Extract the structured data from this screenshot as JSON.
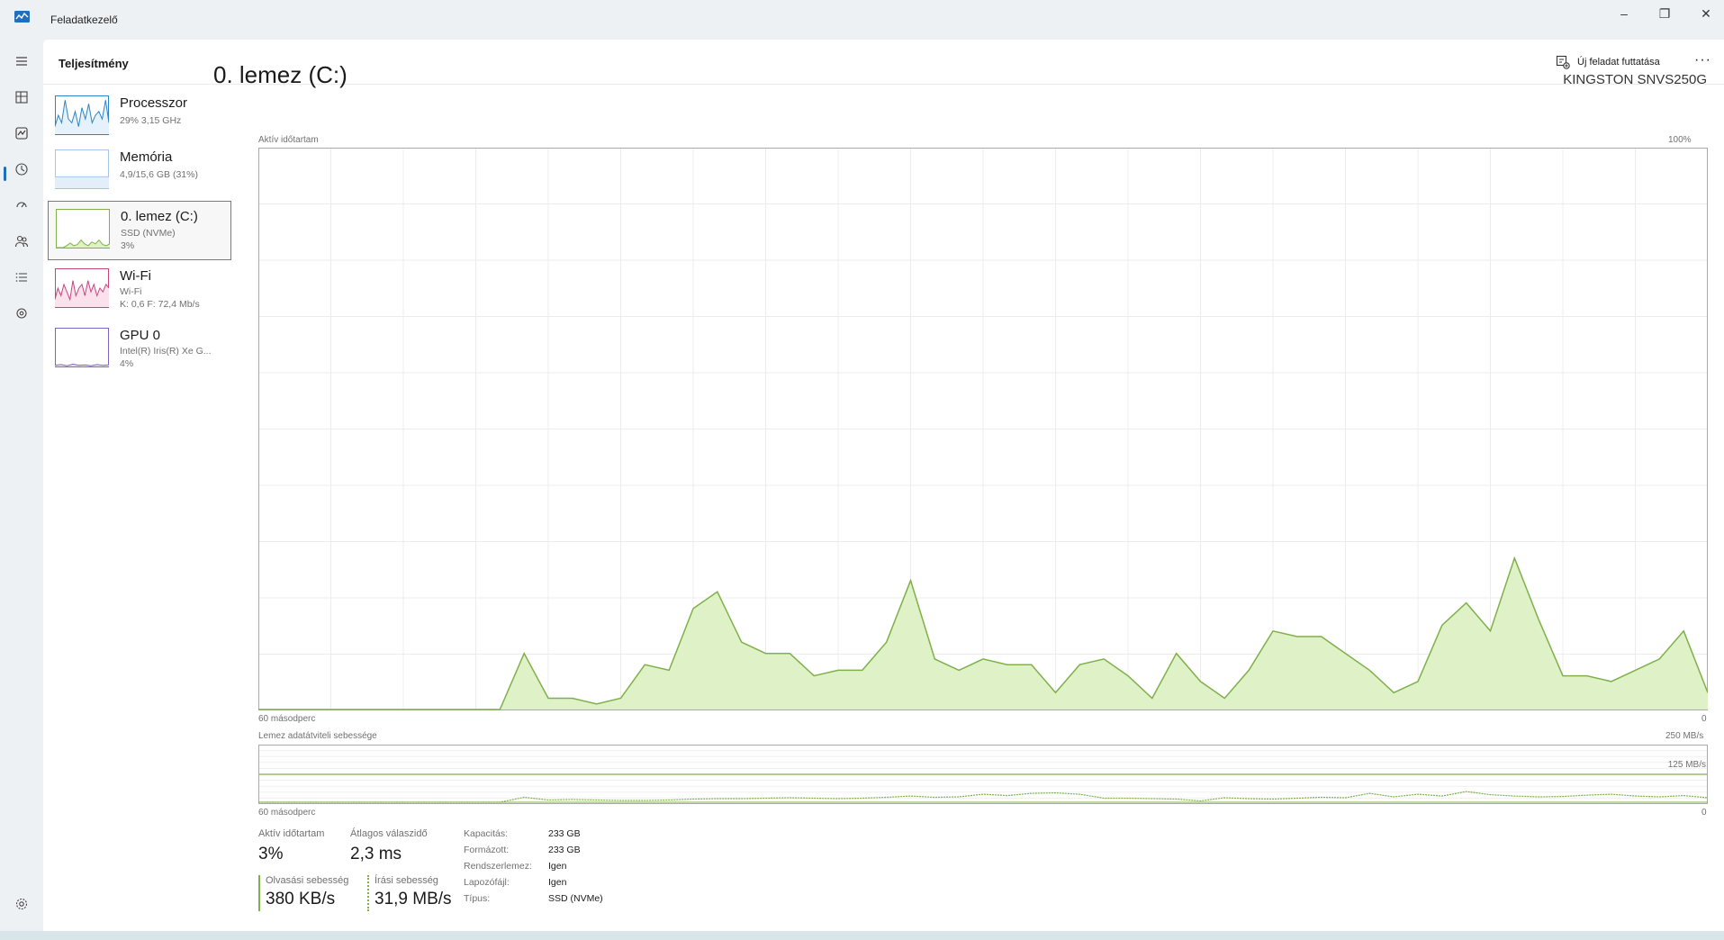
{
  "window": {
    "title": "Feladatkezelő",
    "minimize": "–",
    "maximize": "❐",
    "close": "✕"
  },
  "header": {
    "page_title": "Teljesítmény",
    "run_task_label": "Új feladat futtatása",
    "more_label": "···"
  },
  "devices": [
    {
      "name": "Processzor",
      "line1": "29% 3,15 GHz",
      "line2": ""
    },
    {
      "name": "Memória",
      "line1": "4,9/15,6 GB (31%)",
      "line2": ""
    },
    {
      "name": "0. lemez (C:)",
      "line1": "SSD (NVMe)",
      "line2": "3%"
    },
    {
      "name": "Wi-Fi",
      "line1": "Wi-Fi",
      "line2": "K: 0,6 F: 72,4 Mb/s"
    },
    {
      "name": "GPU 0",
      "line1": "Intel(R) Iris(R) Xe G...",
      "line2": "4%"
    }
  ],
  "detail": {
    "title": "0. lemez (C:)",
    "model": "KINGSTON SNVS250G",
    "active_chart_label": "Aktív időtartam",
    "active_chart_max": "100%",
    "time_left": "60 másodperc",
    "time_right": "0",
    "transfer_label": "Lemez adatátviteli sebessége",
    "transfer_max": "250 MB/s",
    "transfer_mid": "125 MB/s",
    "transfer_time_left": "60 másodperc",
    "transfer_time_right": "0"
  },
  "stats": {
    "active_label": "Aktív időtartam",
    "active_value": "3%",
    "response_label": "Átlagos válaszidő",
    "response_value": "2,3 ms",
    "read_label": "Olvasási sebesség",
    "read_value": "380 KB/s",
    "write_label": "Írási sebesség",
    "write_value": "31,9 MB/s"
  },
  "properties": [
    {
      "label": "Kapacitás:",
      "value": "233 GB"
    },
    {
      "label": "Formázott:",
      "value": "233 GB"
    },
    {
      "label": "Rendszerlemez:",
      "value": "Igen"
    },
    {
      "label": "Lapozófájl:",
      "value": "Igen"
    },
    {
      "label": "Típus:",
      "value": "SSD (NVMe)"
    }
  ],
  "activity_series": {
    "unit": "%",
    "values": [
      0,
      0,
      0,
      0,
      0,
      0,
      0,
      0,
      0,
      0,
      0,
      10,
      2,
      2,
      1,
      2,
      8,
      7,
      18,
      21,
      12,
      10,
      10,
      6,
      7,
      7,
      12,
      23,
      9,
      7,
      9,
      8,
      8,
      3,
      8,
      9,
      6,
      2,
      10,
      5,
      2,
      7,
      14,
      13,
      13,
      10,
      7,
      3,
      5,
      15,
      19,
      14,
      27,
      16,
      6,
      6,
      5,
      7,
      9,
      14,
      3
    ]
  },
  "transfer_series": {
    "unit": "MB/s",
    "values": [
      0,
      0,
      0,
      0,
      0,
      0,
      0,
      0,
      0,
      0,
      0,
      11,
      5,
      6,
      5,
      4,
      4,
      5,
      7,
      8,
      8,
      9,
      10,
      9,
      8,
      9,
      11,
      14,
      11,
      12,
      18,
      15,
      20,
      21,
      18,
      9,
      9,
      8,
      7,
      3,
      10,
      8,
      7,
      9,
      11,
      10,
      20,
      12,
      18,
      14,
      24,
      17,
      14,
      12,
      13,
      16,
      18,
      14,
      12,
      15,
      10
    ]
  },
  "colors": {
    "disk_fill": "#dff2c7",
    "disk_line": "#7fb04a",
    "cpu": "#2c84c6",
    "mem": "#a7c4ea",
    "wifi": "#c8447f",
    "gpu": "#7e62c6",
    "accent": "#1f6fbf"
  }
}
